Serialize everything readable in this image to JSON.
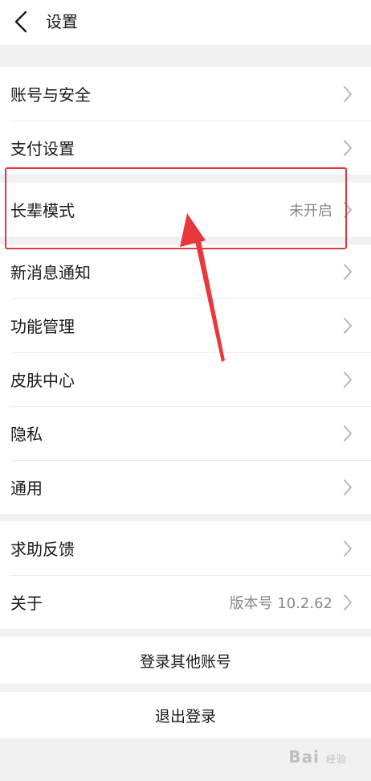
{
  "header": {
    "title": "设置"
  },
  "groups": [
    {
      "items": [
        {
          "label": "账号与安全",
          "value": ""
        },
        {
          "label": "支付设置",
          "value": ""
        }
      ]
    },
    {
      "items": [
        {
          "label": "长辈模式",
          "value": "未开启"
        }
      ]
    },
    {
      "items": [
        {
          "label": "新消息通知",
          "value": ""
        },
        {
          "label": "功能管理",
          "value": ""
        },
        {
          "label": "皮肤中心",
          "value": ""
        },
        {
          "label": "隐私",
          "value": ""
        },
        {
          "label": "通用",
          "value": ""
        }
      ]
    },
    {
      "items": [
        {
          "label": "求助反馈",
          "value": ""
        },
        {
          "label": "关于",
          "value": "版本号 10.2.62"
        }
      ]
    }
  ],
  "actions": {
    "switch_account": "登录其他账号",
    "logout": "退出登录"
  },
  "watermark": {
    "text": "Bai",
    "suffix": "经验"
  },
  "colors": {
    "annotation": "#e8383d",
    "background": "#f1f1f1",
    "value_text": "#8a8a8a"
  }
}
